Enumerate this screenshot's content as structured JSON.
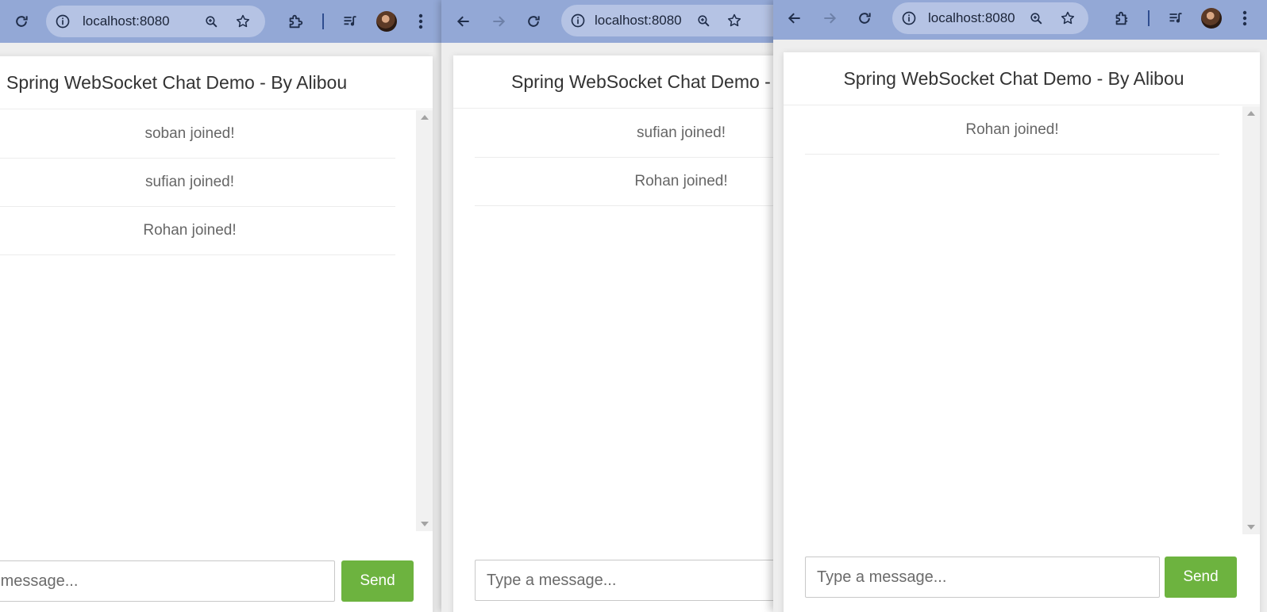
{
  "browser": {
    "address": "localhost:8080"
  },
  "chat": {
    "title": "Spring WebSocket Chat Demo - By Alibou",
    "input_placeholder": "Type a message...",
    "send_label": "Send"
  },
  "windows": [
    {
      "messages": [
        "soban joined!",
        "sufian joined!",
        "Rohan joined!"
      ]
    },
    {
      "messages": [
        "sufian joined!",
        "Rohan joined!"
      ]
    },
    {
      "messages": [
        "Rohan joined!"
      ]
    }
  ],
  "colors": {
    "toolbar": "#93a8d6",
    "omnibox": "#b5c3e4",
    "send_button": "#6db33f",
    "page_background": "#eeeeee"
  },
  "icons": [
    "reload-icon",
    "back-icon",
    "forward-icon",
    "site-info-icon",
    "zoom-icon",
    "bookmark-star-icon",
    "extensions-icon",
    "media-queue-icon",
    "profile-avatar",
    "menu-icon"
  ]
}
